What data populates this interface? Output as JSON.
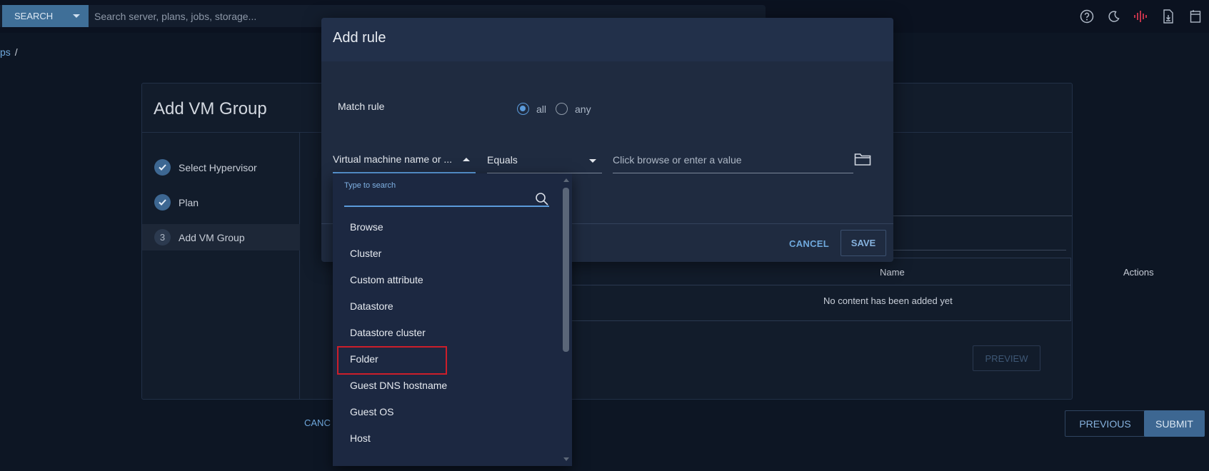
{
  "topbar": {
    "search_button_label": "SEARCH",
    "search_placeholder": "Search server, plans, jobs, storage...",
    "icons": [
      "help-icon",
      "moon-icon",
      "activity-icon",
      "download-file-icon",
      "calendar-icon"
    ]
  },
  "breadcrumb": {
    "partial_link": "ps",
    "separator": "/"
  },
  "page": {
    "title": "Add VM Group",
    "steps": [
      {
        "label": "Select Hypervisor",
        "state": "done"
      },
      {
        "label": "Plan",
        "state": "done"
      },
      {
        "number": "3",
        "label": "Add VM Group",
        "state": "active"
      }
    ],
    "table": {
      "columns": [
        "Name",
        "Actions"
      ],
      "empty_message": "No content has been added yet"
    },
    "preview_label": "PREVIEW",
    "cancel_label": "CANC",
    "previous_label": "PREVIOUS",
    "submit_label": "SUBMIT"
  },
  "modal": {
    "title": "Add rule",
    "match_rule_label": "Match rule",
    "match_options": [
      {
        "label": "all",
        "checked": true
      },
      {
        "label": "any",
        "checked": false
      }
    ],
    "field_select": "Virtual machine name or ...",
    "operator_select": "Equals",
    "value_placeholder": "Click browse or enter a value",
    "cancel_label": "CANCEL",
    "save_label": "SAVE"
  },
  "dropdown": {
    "search_label": "Type to search",
    "items": [
      "Browse",
      "Cluster",
      "Custom attribute",
      "Datastore",
      "Datastore cluster",
      "Folder",
      "Guest DNS hostname",
      "Guest OS",
      "Host"
    ],
    "highlighted_item": "Folder"
  },
  "colors": {
    "accent": "#5b9bdb",
    "button_primary": "#3d6792",
    "highlight_box": "#cc1e2a",
    "background": "#0d1624",
    "modal": "#1f2b40"
  }
}
